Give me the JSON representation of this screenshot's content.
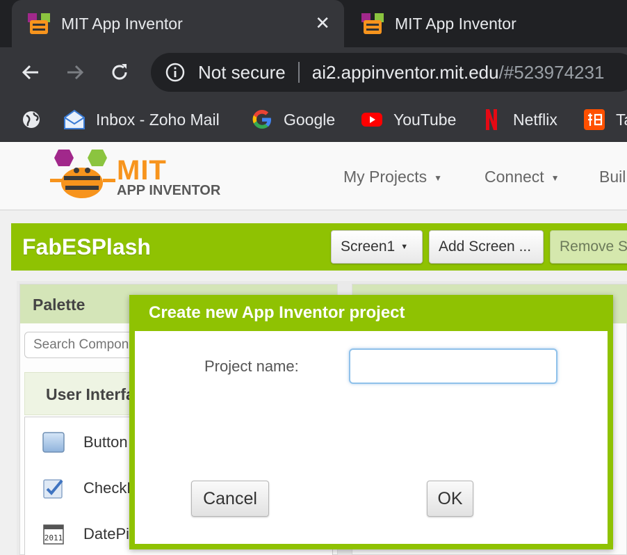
{
  "browser": {
    "tabs": [
      {
        "title": "MIT App Inventor",
        "active": true
      },
      {
        "title": "MIT App Inventor",
        "active": false
      }
    ],
    "tab_close_glyph": "✕",
    "address": {
      "security_label": "Not secure",
      "host": "ai2.appinventor.mit.edu",
      "path": "/#523974231"
    },
    "bookmarks": [
      {
        "label": "",
        "icon": "globe-icon"
      },
      {
        "label": "Inbox - Zoho Mail",
        "icon": "zoho-mail-icon"
      },
      {
        "label": "Google",
        "icon": "google-icon"
      },
      {
        "label": "YouTube",
        "icon": "youtube-icon"
      },
      {
        "label": "Netflix",
        "icon": "netflix-icon"
      },
      {
        "label": "Ta",
        "icon": "taobao-icon"
      }
    ]
  },
  "app": {
    "logo": {
      "line1": "MIT",
      "line2": "APP INVENTOR"
    },
    "menu": [
      {
        "label": "My Projects",
        "caret": "▼"
      },
      {
        "label": "Connect",
        "caret": "▼"
      },
      {
        "label": "Buil"
      }
    ],
    "project": {
      "name": "FabESPlash",
      "screen_select": {
        "label": "Screen1",
        "caret": "▼"
      },
      "add_screen_label": "Add Screen ...",
      "remove_screen_label": "Remove S"
    },
    "palette": {
      "title": "Palette",
      "search_placeholder": "Search Components...",
      "category": "User Interface",
      "components": [
        {
          "label": "Button",
          "icon": "button-icon"
        },
        {
          "label": "CheckBox",
          "icon": "checkbox-icon"
        },
        {
          "label": "DatePicker",
          "icon": "datepicker-icon"
        }
      ]
    }
  },
  "dialog": {
    "title": "Create new App Inventor project",
    "project_name_label": "Project name:",
    "project_name_value": "",
    "cancel_label": "Cancel",
    "ok_label": "OK"
  },
  "colors": {
    "accent_green": "#8fc202",
    "logo_orange": "#f7941d",
    "chrome_dark": "#202124",
    "chrome_toolbar": "#35363a"
  }
}
